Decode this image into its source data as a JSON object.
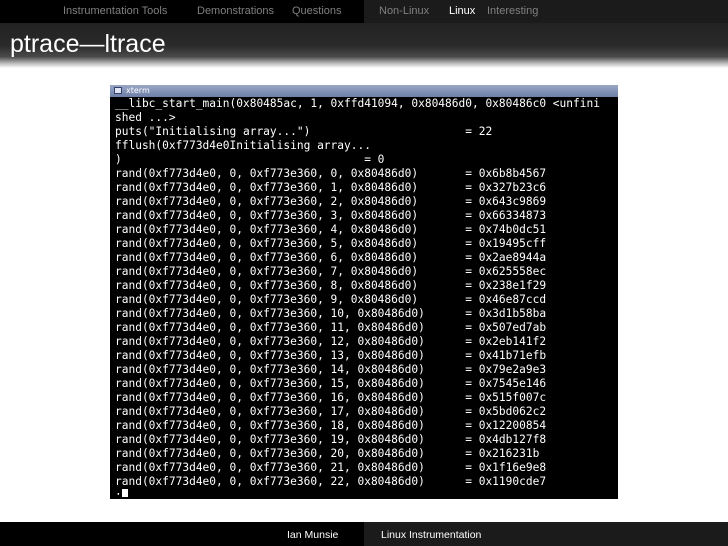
{
  "nav": {
    "left": [
      "Instrumentation Tools",
      "Demonstrations",
      "Questions"
    ],
    "right": [
      "Non-Linux",
      "Linux",
      "Interesting"
    ]
  },
  "slide": {
    "title": "ptrace—ltrace"
  },
  "terminal": {
    "window_title": "xterm",
    "lines": [
      "__libc_start_main(0x80485ac, 1, 0xffd41094, 0x80486d0, 0x80486c0 <unfini",
      "shed ...>",
      "puts(\"Initialising array...\")                       = 22",
      "fflush(0xf773d4e0Initialising array...",
      ")                                    = 0",
      "rand(0xf773d4e0, 0, 0xf773e360, 0, 0x80486d0)       = 0x6b8b4567",
      "rand(0xf773d4e0, 0, 0xf773e360, 1, 0x80486d0)       = 0x327b23c6",
      "rand(0xf773d4e0, 0, 0xf773e360, 2, 0x80486d0)       = 0x643c9869",
      "rand(0xf773d4e0, 0, 0xf773e360, 3, 0x80486d0)       = 0x66334873",
      "rand(0xf773d4e0, 0, 0xf773e360, 4, 0x80486d0)       = 0x74b0dc51",
      "rand(0xf773d4e0, 0, 0xf773e360, 5, 0x80486d0)       = 0x19495cff",
      "rand(0xf773d4e0, 0, 0xf773e360, 6, 0x80486d0)       = 0x2ae8944a",
      "rand(0xf773d4e0, 0, 0xf773e360, 7, 0x80486d0)       = 0x625558ec",
      "rand(0xf773d4e0, 0, 0xf773e360, 8, 0x80486d0)       = 0x238e1f29",
      "rand(0xf773d4e0, 0, 0xf773e360, 9, 0x80486d0)       = 0x46e87ccd",
      "rand(0xf773d4e0, 0, 0xf773e360, 10, 0x80486d0)      = 0x3d1b58ba",
      "rand(0xf773d4e0, 0, 0xf773e360, 11, 0x80486d0)      = 0x507ed7ab",
      "rand(0xf773d4e0, 0, 0xf773e360, 12, 0x80486d0)      = 0x2eb141f2",
      "rand(0xf773d4e0, 0, 0xf773e360, 13, 0x80486d0)      = 0x41b71efb",
      "rand(0xf773d4e0, 0, 0xf773e360, 14, 0x80486d0)      = 0x79e2a9e3",
      "rand(0xf773d4e0, 0, 0xf773e360, 15, 0x80486d0)      = 0x7545e146",
      "rand(0xf773d4e0, 0, 0xf773e360, 16, 0x80486d0)      = 0x515f007c",
      "rand(0xf773d4e0, 0, 0xf773e360, 17, 0x80486d0)      = 0x5bd062c2",
      "rand(0xf773d4e0, 0, 0xf773e360, 18, 0x80486d0)      = 0x12200854",
      "rand(0xf773d4e0, 0, 0xf773e360, 19, 0x80486d0)      = 0x4db127f8",
      "rand(0xf773d4e0, 0, 0xf773e360, 20, 0x80486d0)      = 0x216231b",
      "rand(0xf773d4e0, 0, 0xf773e360, 21, 0x80486d0)      = 0x1f16e9e8",
      "rand(0xf773d4e0, 0, 0xf773e360, 22, 0x80486d0)      = 0x1190cde7"
    ],
    "prompt": ":"
  },
  "footer": {
    "author": "Ian Munsie",
    "talk": "Linux Instrumentation"
  },
  "colors": {
    "bar_dark": "#000000",
    "bar_right": "#1b1b1b",
    "nav_inactive": "#808080",
    "nav_active": "#ffffff"
  }
}
